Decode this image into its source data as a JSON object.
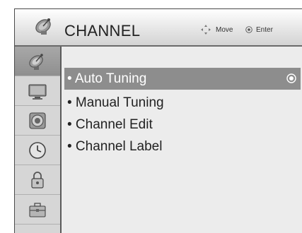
{
  "header": {
    "title": "CHANNEL",
    "icon": "satellite-dish-icon",
    "hints": {
      "move_label": "Move",
      "enter_label": "Enter"
    }
  },
  "sidebar": {
    "items": [
      {
        "icon": "satellite-dish-icon",
        "active": true
      },
      {
        "icon": "monitor-icon",
        "active": false
      },
      {
        "icon": "speaker-icon",
        "active": false
      },
      {
        "icon": "clock-icon",
        "active": false
      },
      {
        "icon": "lock-icon",
        "active": false
      },
      {
        "icon": "toolbox-icon",
        "active": false
      }
    ]
  },
  "menu": {
    "items": [
      {
        "label": "• Auto Tuning",
        "selected": true
      },
      {
        "label": "• Manual Tuning",
        "selected": false
      },
      {
        "label": "• Channel Edit",
        "selected": false
      },
      {
        "label": "• Channel Label",
        "selected": false
      }
    ]
  },
  "colors": {
    "selection": "#8d8d8d",
    "panel": "#ececec",
    "sidebar": "#d6d6d6"
  }
}
